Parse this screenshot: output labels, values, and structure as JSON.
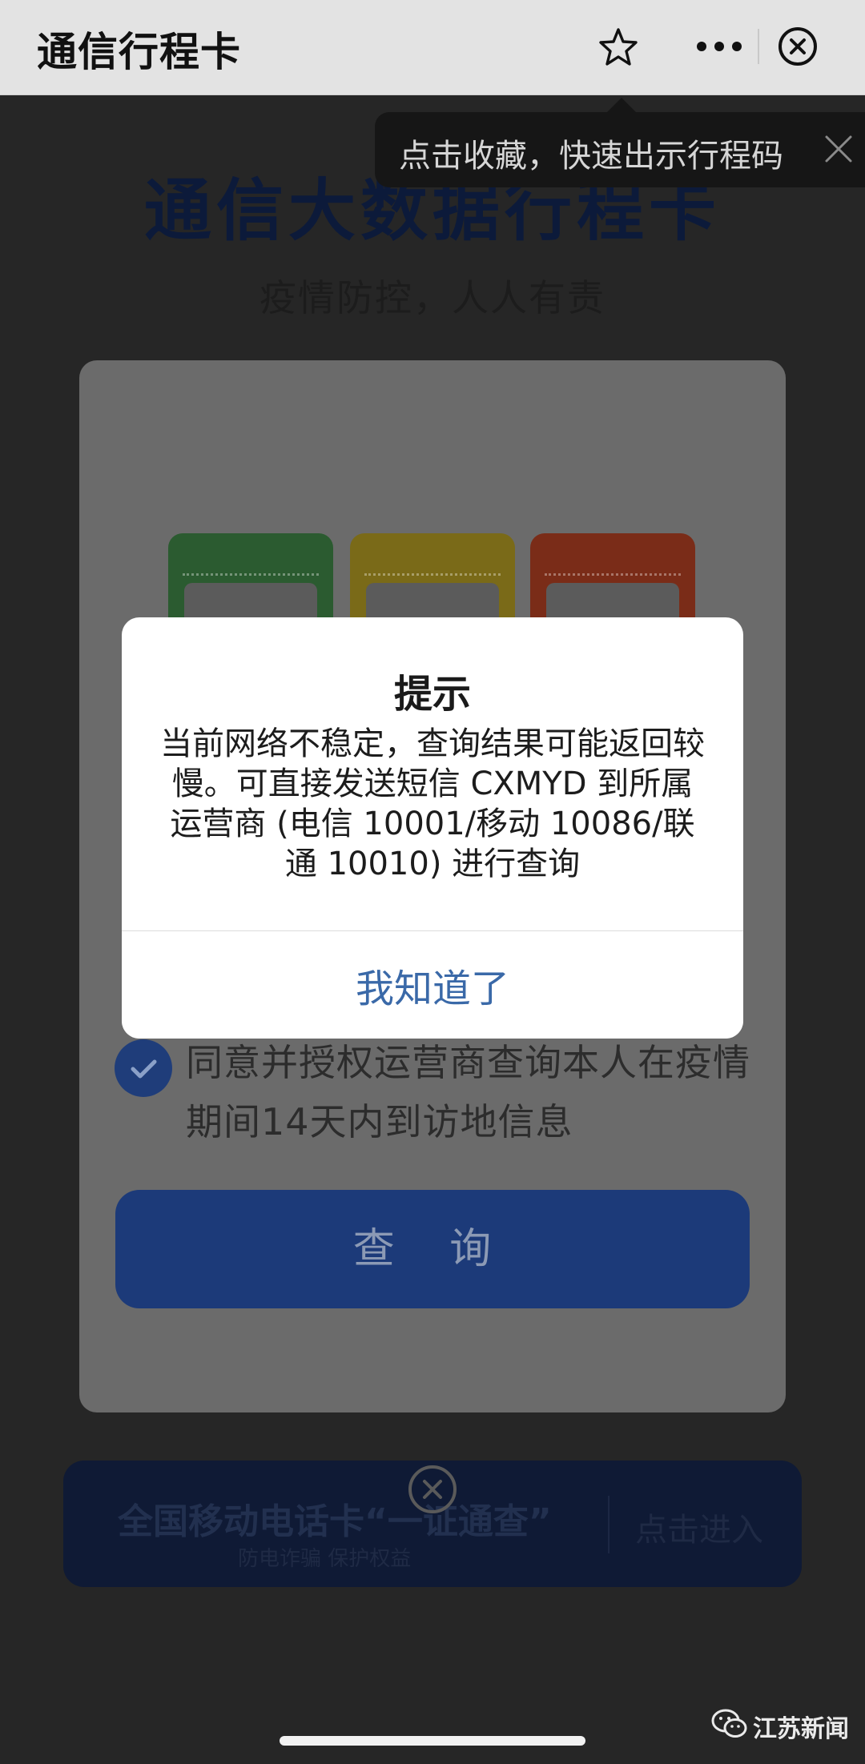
{
  "topbar": {
    "title": "通信行程卡"
  },
  "tooltip": {
    "text": "点击收藏，快速出示行程码"
  },
  "page": {
    "heading": "通信大数据行程卡",
    "subheading": "疫情防控，人人有责",
    "agree_text": "同意并授权运营商查询本人在疫情期间14天内到访地信息",
    "query_label": "查 询",
    "banner_title": "全国移动电话卡“一证通查”",
    "banner_subtitle": "防电诈骗 保护权益",
    "banner_enter": "点击进入"
  },
  "dialog": {
    "title": "提示",
    "message": "当前网络不稳定，查询结果可能返回较慢。可直接发送短信 CXMYD 到所属运营商 (电信 10001/移动 10086/联通 10010) 进行查询",
    "confirm_label": "我知道了"
  },
  "watermark": {
    "text": "江苏新闻"
  },
  "colors": {
    "accent": "#3a69a8",
    "query_button": "#2a5ad6",
    "ticket_green": "#3fae4a",
    "ticket_yellow": "#f0c419",
    "ticket_red": "#e2512a"
  }
}
